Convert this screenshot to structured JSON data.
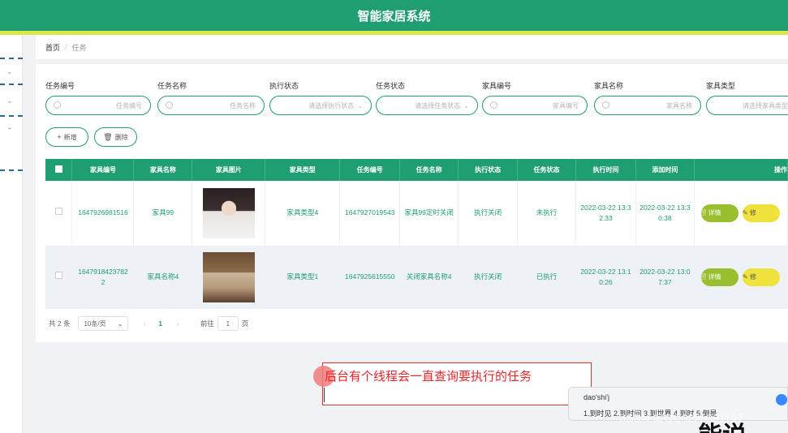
{
  "app": {
    "title": "智能家居系统"
  },
  "breadcrumb": {
    "home": "首页",
    "separator": "/",
    "current": "任务"
  },
  "filters": [
    {
      "label": "任务编号",
      "placeholder": "任务编号",
      "kind": "text"
    },
    {
      "label": "任务名称",
      "placeholder": "任务名称",
      "kind": "text"
    },
    {
      "label": "执行状态",
      "placeholder": "请选择执行状态",
      "kind": "select"
    },
    {
      "label": "任务状态",
      "placeholder": "请选择任务状态",
      "kind": "select"
    },
    {
      "label": "家具编号",
      "placeholder": "家具编号",
      "kind": "text"
    },
    {
      "label": "家具名称",
      "placeholder": "家具名称",
      "kind": "text"
    },
    {
      "label": "家具类型",
      "placeholder": "请选择家具类型",
      "kind": "select"
    }
  ],
  "actions": {
    "add_label": "新增",
    "delete_label": "删除"
  },
  "table": {
    "headers": [
      "家具编号",
      "家具名称",
      "家具图片",
      "家具类型",
      "任务编号",
      "任务名称",
      "执行状态",
      "任务状态",
      "执行时间",
      "添加时间",
      "操作"
    ],
    "rows": [
      {
        "furniture_no": "1647926981516",
        "furniture_name": "家具99",
        "image": "portrait-photo",
        "furniture_type": "家具类型4",
        "task_no": "1647927019543",
        "task_name": "家具99定时关闭",
        "exec_status": "执行关闭",
        "task_status": "未执行",
        "exec_time": "2022-03-22 13:32:33",
        "add_time": "2022-03-22 13:30:38"
      },
      {
        "furniture_no": "1647918423782 2",
        "furniture_name": "家具名称4",
        "image": "living-room-photo",
        "furniture_type": "家具类型1",
        "task_no": "1647925615550",
        "task_name": "关闭家具名称4",
        "exec_status": "执行关闭",
        "task_status": "已执行",
        "exec_time": "2022-03-22 13:10:26",
        "add_time": "2022-03-22 13:07:37"
      }
    ],
    "detail_label": "详情",
    "edit_label": "修"
  },
  "pagination": {
    "total": "共 2 条",
    "page_size": "10条/页",
    "current": "1",
    "goto_label": "前往",
    "goto_value": "1",
    "page_unit": "页"
  },
  "annotation": {
    "text": "后台有个线程会一直查询要执行的任务"
  },
  "ime": {
    "pinyin": "dao'shi'j",
    "candidates": "1.到时见   2.到时间   3.到世界   4.到时   5.倒是"
  },
  "watermark": "CSDN @QQ3295391197",
  "colors": {
    "primary": "#1f9e72",
    "accent_strip": "#d6e84a",
    "detail_btn": "#9abf2e",
    "edit_btn": "#f0e23d",
    "annotation": "#e8272d"
  }
}
